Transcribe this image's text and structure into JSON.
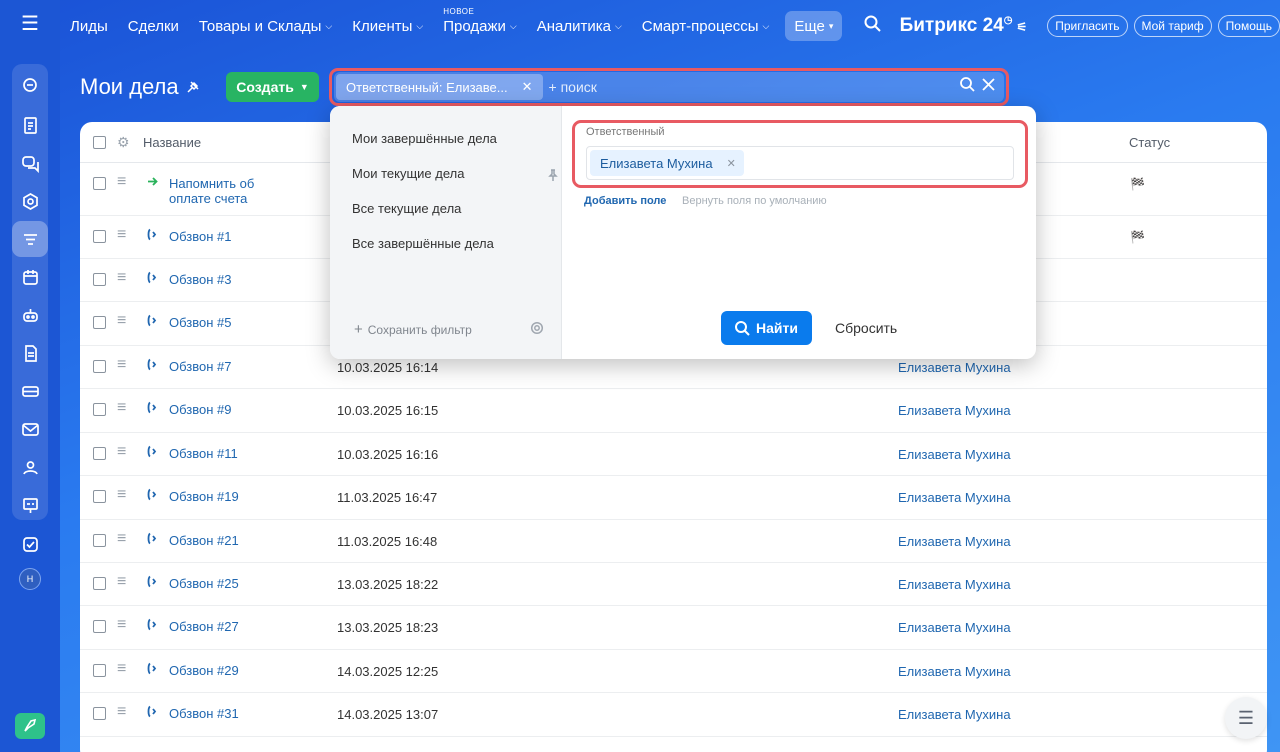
{
  "nav": {
    "items": [
      {
        "label": "Лиды",
        "chevron": false
      },
      {
        "label": "Сделки",
        "chevron": false
      },
      {
        "label": "Товары и Склады",
        "chevron": true
      },
      {
        "label": "Клиенты",
        "chevron": true
      },
      {
        "label": "Продажи",
        "chevron": true,
        "badge": "НОВОЕ"
      },
      {
        "label": "Аналитика",
        "chevron": true
      },
      {
        "label": "Смарт-процессы",
        "chevron": true
      }
    ],
    "more_label": "Еще",
    "logo_text": "Битрикс",
    "logo_num": "24",
    "invite_label": "Пригласить",
    "tariff_label": "Мой тариф",
    "help_label": "Помощь"
  },
  "sidebar": {
    "icons": [
      "crm-icon",
      "document-icon",
      "chat-icon",
      "hexagon-icon",
      "filter-icon",
      "calendar-icon",
      "robot-icon",
      "file-icon",
      "storage-icon",
      "mail-icon",
      "users-icon",
      "presentation-icon",
      "checkbox-icon"
    ],
    "avatar_initial": "Н"
  },
  "page": {
    "title": "Мои дела",
    "create_label": "Создать"
  },
  "filter": {
    "chip_label": "Ответственный: Елизаве...",
    "placeholder": "+ поиск",
    "presets": [
      "Мои завершённые дела",
      "Мои текущие дела",
      "Все текущие дела",
      "Все завершённые дела"
    ],
    "save_label": "Сохранить фильтр",
    "field_label": "Ответственный",
    "field_value": "Елизавета Мухина",
    "add_field": "Добавить поле",
    "reset_fields": "Вернуть поля по умолчанию",
    "find_label": "Найти",
    "reset_label": "Сбросить"
  },
  "grid": {
    "col_name": "Название",
    "col_status": "Статус",
    "rows": [
      {
        "title": "Напомнить об оплате счета",
        "date": "",
        "resp": "",
        "status": "flag",
        "type": "reminder"
      },
      {
        "title": "Обзвон #1",
        "date": "",
        "resp": "",
        "status": "flag",
        "type": "call"
      },
      {
        "title": "Обзвон #3",
        "date": "",
        "resp": "",
        "status": "",
        "type": "call"
      },
      {
        "title": "Обзвон #5",
        "date": "",
        "resp": "",
        "status": "",
        "type": "call"
      },
      {
        "title": "Обзвон #7",
        "date": "10.03.2025 16:14",
        "resp": "Елизавета Мухина",
        "status": "",
        "type": "call"
      },
      {
        "title": "Обзвон #9",
        "date": "10.03.2025 16:15",
        "resp": "Елизавета Мухина",
        "status": "",
        "type": "call"
      },
      {
        "title": "Обзвон #11",
        "date": "10.03.2025 16:16",
        "resp": "Елизавета Мухина",
        "status": "",
        "type": "call"
      },
      {
        "title": "Обзвон #19",
        "date": "11.03.2025 16:47",
        "resp": "Елизавета Мухина",
        "status": "",
        "type": "call"
      },
      {
        "title": "Обзвон #21",
        "date": "11.03.2025 16:48",
        "resp": "Елизавета Мухина",
        "status": "",
        "type": "call"
      },
      {
        "title": "Обзвон #25",
        "date": "13.03.2025 18:22",
        "resp": "Елизавета Мухина",
        "status": "",
        "type": "call"
      },
      {
        "title": "Обзвон #27",
        "date": "13.03.2025 18:23",
        "resp": "Елизавета Мухина",
        "status": "",
        "type": "call"
      },
      {
        "title": "Обзвон #29",
        "date": "14.03.2025 12:25",
        "resp": "Елизавета Мухина",
        "status": "",
        "type": "call"
      },
      {
        "title": "Обзвон #31",
        "date": "14.03.2025 13:07",
        "resp": "Елизавета Мухина",
        "status": "",
        "type": "call"
      }
    ]
  },
  "colors": {
    "accent": "#0a7bed",
    "create": "#28b463",
    "highlight": "#e85a62",
    "link": "#2067b0"
  }
}
